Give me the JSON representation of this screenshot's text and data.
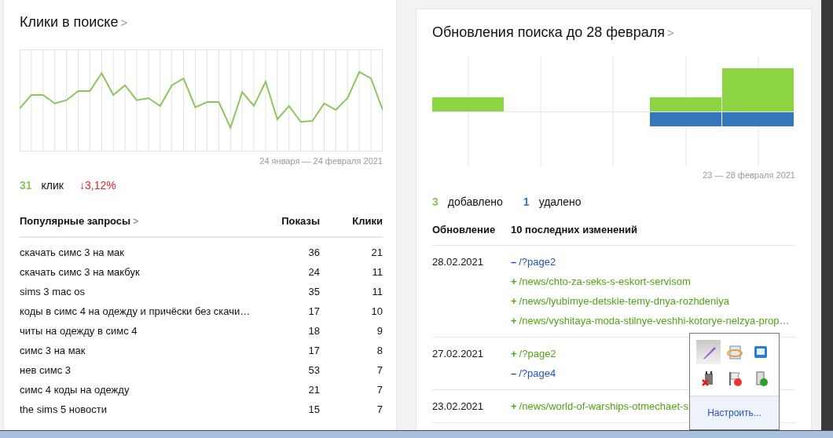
{
  "clicks_card": {
    "title": "Клики в поиске",
    "arrow": ">",
    "period": "24 января — 24 февраля 2021",
    "total": "31",
    "total_label": "клик",
    "change": "↓3,12%"
  },
  "popular_queries": {
    "title": "Популярные запросы",
    "arrow": ">",
    "columns": [
      "Показы",
      "Клики"
    ],
    "rows": [
      {
        "query": "скачать симс 3 на мак",
        "shows": "36",
        "clicks": "21"
      },
      {
        "query": "скачать симс 3 на макбук",
        "shows": "24",
        "clicks": "11"
      },
      {
        "query": "sims 3 mac os",
        "shows": "35",
        "clicks": "11"
      },
      {
        "query": "коды в симс 4 на одежду и причёски без скачи…",
        "shows": "17",
        "clicks": "10"
      },
      {
        "query": "читы на одежду в симс 4",
        "shows": "18",
        "clicks": "9"
      },
      {
        "query": "симс 3 на мак",
        "shows": "17",
        "clicks": "8"
      },
      {
        "query": "нев симс 3",
        "shows": "53",
        "clicks": "7"
      },
      {
        "query": "симс 4 коды на одежду",
        "shows": "21",
        "clicks": "7"
      },
      {
        "query": "the sims 5 новости",
        "shows": "15",
        "clicks": "7"
      }
    ]
  },
  "updates_card": {
    "title": "Обновления поиска до 28 февраля",
    "arrow": ">",
    "period": "23 — 28 февраля 2021",
    "added": "3",
    "added_label": "добавлено",
    "removed": "1",
    "removed_label": "удалено",
    "columns": [
      "Обновление",
      "10 последних изменений"
    ],
    "groups": [
      {
        "date": "28.02.2021",
        "changes": [
          {
            "kind": "removed",
            "sign": "–",
            "path": "/?page2"
          },
          {
            "kind": "added",
            "sign": "+",
            "path": "/news/chto-za-seks-s-eskort-servisom"
          },
          {
            "kind": "added",
            "sign": "+",
            "path": "/news/lyubimye-detskie-temy-dnya-rozhdeniya"
          },
          {
            "kind": "added",
            "sign": "+",
            "path": "/news/vyshitaya-moda-stilnye-veshhi-kotorye-nelzya-prop…"
          }
        ]
      },
      {
        "date": "27.02.2021",
        "changes": [
          {
            "kind": "added",
            "sign": "+",
            "path": "/?page2"
          },
          {
            "kind": "removed",
            "sign": "–",
            "path": "/?page4"
          }
        ]
      },
      {
        "date": "23.02.2021",
        "changes": [
          {
            "kind": "added",
            "sign": "+",
            "path": "/news/world-of-warships-otmechaet-s"
          }
        ]
      }
    ]
  },
  "tray_popup": {
    "icons": [
      {
        "selected": true
      },
      {
        "selected": false
      },
      {
        "selected": false
      },
      {
        "selected": false
      },
      {
        "selected": false
      },
      {
        "selected": false
      }
    ],
    "link": "Настроить..."
  }
}
